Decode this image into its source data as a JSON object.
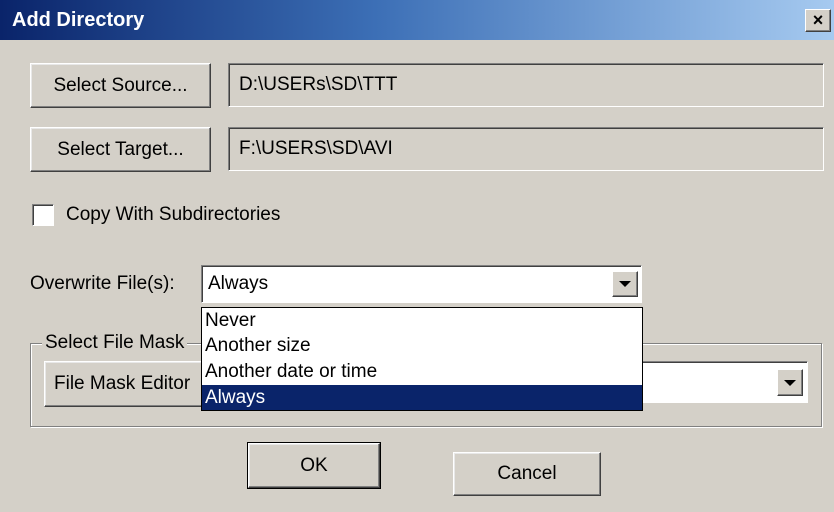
{
  "window": {
    "title": "Add Directory",
    "close_glyph": "×"
  },
  "source": {
    "button_label": "Select Source...",
    "path": "D:\\USERs\\SD\\TTT"
  },
  "target": {
    "button_label": "Select Target...",
    "path": "F:\\USERS\\SD\\AVI"
  },
  "copy_subdirs": {
    "label": "Copy With Subdirectories",
    "checked": false
  },
  "overwrite": {
    "label": "Overwrite File(s):",
    "selected": "Always",
    "options": [
      "Never",
      "Another size",
      "Another date or time",
      "Always"
    ]
  },
  "file_mask": {
    "group_label": "Select File Mask",
    "editor_button_label": "File Mask Editor"
  },
  "buttons": {
    "ok_label": "OK",
    "cancel_label": "Cancel"
  },
  "colors": {
    "titlebar_start": "#0a246a",
    "titlebar_end": "#a6caf0",
    "face": "#d4d0c8",
    "selection": "#0a246a"
  }
}
